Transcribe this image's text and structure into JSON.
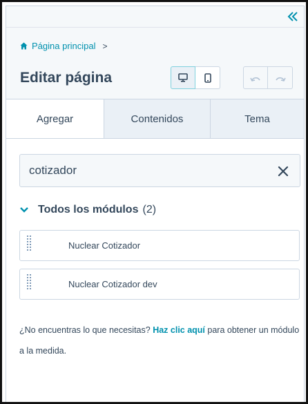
{
  "breadcrumb": {
    "home_label": "Página principal",
    "separator": ">"
  },
  "header": {
    "title": "Editar página"
  },
  "tabs": [
    {
      "label": "Agregar",
      "active": true
    },
    {
      "label": "Contenidos",
      "active": false
    },
    {
      "label": "Tema",
      "active": false
    }
  ],
  "search": {
    "value": "cotizador",
    "placeholder": ""
  },
  "section": {
    "title": "Todos los módulos",
    "count": "(2)"
  },
  "modules": [
    {
      "label": "Nuclear Cotizador"
    },
    {
      "label": "Nuclear Cotizador dev"
    }
  ],
  "help": {
    "prefix": "¿No encuentras lo que necesitas?",
    "link": "Haz clic aquí",
    "suffix": "para obtener un módulo a la medida."
  },
  "icons": {
    "collapse": "double-chevron-left-icon",
    "home": "home-icon",
    "desktop": "desktop-icon",
    "mobile": "mobile-icon",
    "undo": "undo-icon",
    "redo": "redo-icon",
    "clear": "close-icon",
    "section": "chevron-down-icon",
    "grip": "drag-handle-icon"
  },
  "colors": {
    "accent": "#0091ae",
    "text": "#33475b",
    "border": "#cbd6e2",
    "panel_bg": "#f5f8fa",
    "tab_bg": "#eaf0f6"
  }
}
